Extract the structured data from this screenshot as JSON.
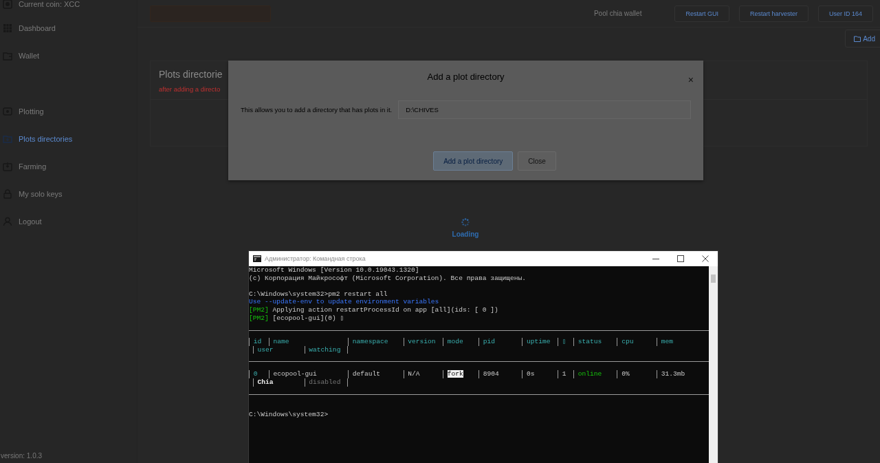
{
  "sidebar": {
    "items": [
      {
        "label": "Current coin: XCC",
        "selected": false
      },
      {
        "label": "Dashboard",
        "selected": false
      },
      {
        "label": "Wallet",
        "selected": false
      },
      {
        "label": "Plotting",
        "selected": false
      },
      {
        "label": "Plots directories",
        "selected": true
      },
      {
        "label": "Farming",
        "selected": false
      },
      {
        "label": "My solo keys",
        "selected": false
      },
      {
        "label": "Logout",
        "selected": false
      }
    ],
    "version": "version: 1.0.3"
  },
  "top_bar": {
    "wallet_label": "Pool chia wallet",
    "buttons": [
      "Restart GUI",
      "Restart harvester",
      "User ID 164"
    ],
    "add_button": "Add"
  },
  "card": {
    "title": "Plots directorie",
    "note": "after adding a directo"
  },
  "modal": {
    "title": "Add a plot directory",
    "close": "×",
    "label": "This allows you to add a directory that has plots in it.",
    "value": "D:\\CHIVES",
    "buttons": [
      {
        "label": "Add a plot directory",
        "kind": "primary"
      },
      {
        "label": "Close",
        "kind": "secondary"
      }
    ]
  },
  "loading": {
    "label": "Loading"
  },
  "console": {
    "title": "Администратор: Командная строка",
    "blocks": [
      [
        [
          {
            "text": "Microsoft Windows [Version 10.0.19043.1320]",
            "kind": "plain"
          }
        ],
        [
          {
            "text": "(c) Корпорация Майкрософт (Microsoft Corporation). Все права защищены.",
            "kind": "plain"
          }
        ]
      ],
      [
        [
          {
            "text": "C:\\Windows\\system32>pm2 restart all",
            "kind": "plain"
          }
        ],
        [
          {
            "text": "Use --update-env to update environment variables",
            "kind": "blue"
          }
        ],
        [
          {
            "text": "[PM2]",
            "kind": "green"
          },
          {
            "text": " Applying action restartProcessId on app [all](ids: [ 0 ])",
            "kind": "plain"
          }
        ],
        [
          {
            "text": "[PM2]",
            "kind": "green"
          },
          {
            "text": " [ecopool-gui](0) ▯",
            "kind": "plain"
          }
        ]
      ]
    ],
    "table": {
      "columns": [
        "id",
        "name",
        "namespace",
        "version",
        "mode",
        "pid",
        "uptime",
        "▯",
        "status",
        "cpu",
        "mem"
      ],
      "sub_columns": [
        "user",
        "watching"
      ],
      "rows": [
        {
          "cells": [
            {
              "text": "0",
              "kind": "cyan"
            },
            {
              "text": "ecopool-gui",
              "kind": "plain"
            },
            {
              "text": "default",
              "kind": "plain"
            },
            {
              "text": "N/A",
              "kind": "plain"
            },
            {
              "text": "fork",
              "kind": "inverse"
            },
            {
              "text": "8904",
              "kind": "plain"
            },
            {
              "text": "0s",
              "kind": "plain"
            },
            {
              "text": "1",
              "kind": "plain"
            },
            {
              "text": "online",
              "kind": "green"
            },
            {
              "text": "0%",
              "kind": "plain"
            },
            {
              "text": "31.3mb",
              "kind": "plain"
            }
          ],
          "sub_cells": [
            {
              "text": "Chia",
              "kind": "bold"
            },
            {
              "text": "disabled",
              "kind": "grey"
            }
          ]
        }
      ]
    },
    "prompt": "C:\\Windows\\system32>"
  }
}
